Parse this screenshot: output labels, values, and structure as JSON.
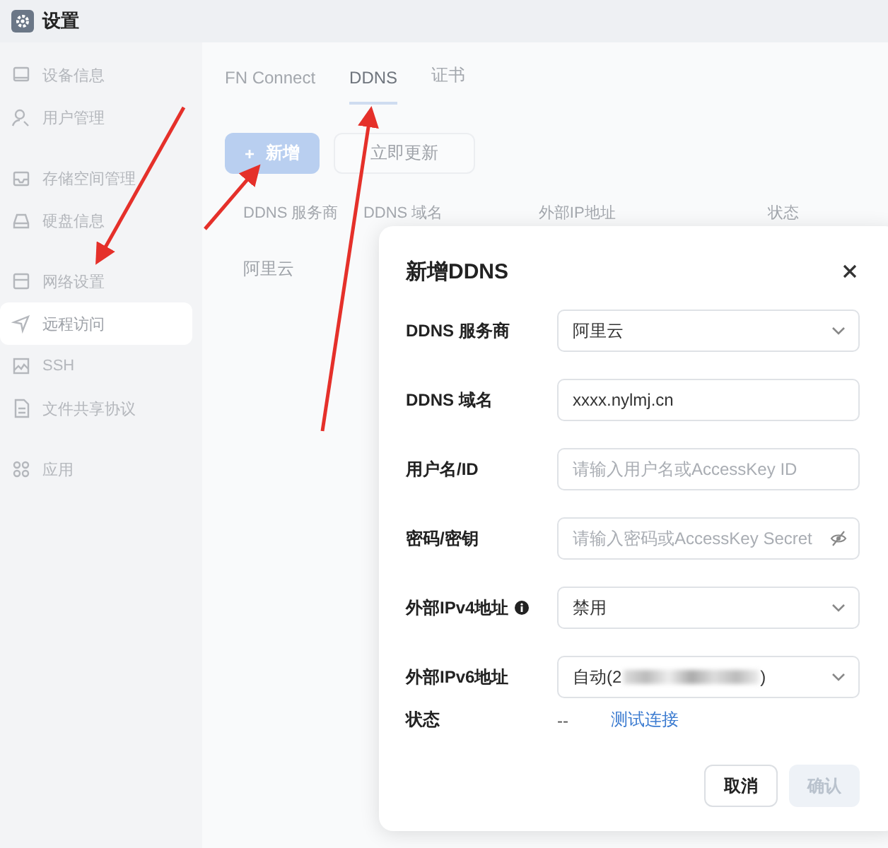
{
  "window": {
    "title": "设置"
  },
  "sidebar": {
    "groups": [
      {
        "items": [
          {
            "label": "设备信息",
            "selected": false
          },
          {
            "label": "用户管理",
            "selected": false
          }
        ]
      },
      {
        "items": [
          {
            "label": "存储空间管理",
            "selected": false
          },
          {
            "label": "硬盘信息",
            "selected": false
          }
        ]
      },
      {
        "items": [
          {
            "label": "网络设置",
            "selected": false
          },
          {
            "label": "远程访问",
            "selected": true
          },
          {
            "label": "SSH",
            "selected": false
          },
          {
            "label": "文件共享协议",
            "selected": false
          }
        ]
      },
      {
        "items": [
          {
            "label": "应用",
            "selected": false
          }
        ]
      }
    ]
  },
  "tabs": [
    {
      "label": "FN Connect",
      "selected": false
    },
    {
      "label": "DDNS",
      "selected": true
    },
    {
      "label": "证书",
      "selected": false
    }
  ],
  "toolbar": [
    {
      "label": "新增",
      "icon": "+",
      "kind": "primary"
    },
    {
      "label": "立即更新",
      "kind": "default"
    }
  ],
  "table": {
    "columns": [
      "DDNS 服务商",
      "DDNS 域名",
      "外部IP地址",
      "状态"
    ],
    "rows": [
      [
        "阿里云"
      ]
    ]
  },
  "dialog": {
    "title": "新增DDNS",
    "fields": [
      {
        "label": "DDNS 服务商",
        "kind": "select",
        "value": "阿里云",
        "info": false
      },
      {
        "label": "DDNS 域名",
        "kind": "input",
        "value": "xxxx.nylmj.cn",
        "info": false
      },
      {
        "label": "用户名/ID",
        "kind": "input",
        "placeholder": "请输入用户名或AccessKey ID",
        "info": false
      },
      {
        "label": "密码/密钥",
        "kind": "password",
        "placeholder": "请输入密码或AccessKey Secret",
        "info": false
      },
      {
        "label": "外部IPv4地址",
        "kind": "select",
        "value": "禁用",
        "info": true
      },
      {
        "label": "外部IPv6地址",
        "kind": "select",
        "value": "自动(2",
        "value_end": ")",
        "redacted": true,
        "info": false
      }
    ],
    "status": {
      "label": "状态",
      "value": "--",
      "link": "测试连接"
    },
    "buttons": [
      {
        "label": "取消",
        "kind": "default",
        "disabled": false
      },
      {
        "label": "确认",
        "kind": "primary",
        "disabled": true
      }
    ]
  }
}
